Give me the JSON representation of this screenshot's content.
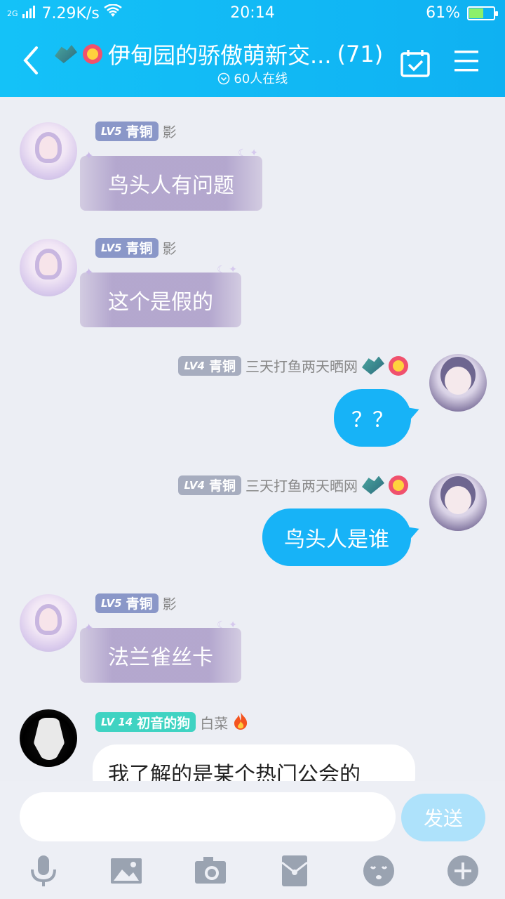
{
  "status_bar": {
    "network": "2G",
    "speed": "7.29K/s",
    "time": "20:14",
    "battery": "61%",
    "battery_level": 0.61
  },
  "header": {
    "title": "伊甸园的骄傲萌新交...",
    "member_count": "(71)",
    "online": "60人在线"
  },
  "messages": [
    {
      "side": "left",
      "level": "LV5",
      "rank": "青铜",
      "nick": "影",
      "text": "鸟头人有问题"
    },
    {
      "side": "left",
      "level": "LV5",
      "rank": "青铜",
      "nick": "影",
      "text": "这个是假的"
    },
    {
      "side": "right",
      "level": "LV4",
      "rank": "青铜",
      "nick": "三天打鱼两天晒网",
      "text": "？？"
    },
    {
      "side": "right",
      "level": "LV4",
      "rank": "青铜",
      "nick": "三天打鱼两天晒网",
      "text": "鸟头人是谁"
    },
    {
      "side": "left",
      "level": "LV5",
      "rank": "青铜",
      "nick": "影",
      "text": "法兰雀丝卡"
    },
    {
      "side": "left",
      "level": "LV 14",
      "rank": "初音的狗",
      "nick": "白菜",
      "text": "我了解的是某个热门公会的"
    }
  ],
  "input": {
    "placeholder": "",
    "send_label": "发送"
  },
  "toolbar": [
    "microphone-icon",
    "image-icon",
    "camera-icon",
    "red-packet-icon",
    "emoji-icon",
    "plus-icon"
  ],
  "colors": {
    "header": "#14c2f8",
    "bubble_blue": "#17b3f7",
    "send_disabled": "#aee2fb"
  }
}
